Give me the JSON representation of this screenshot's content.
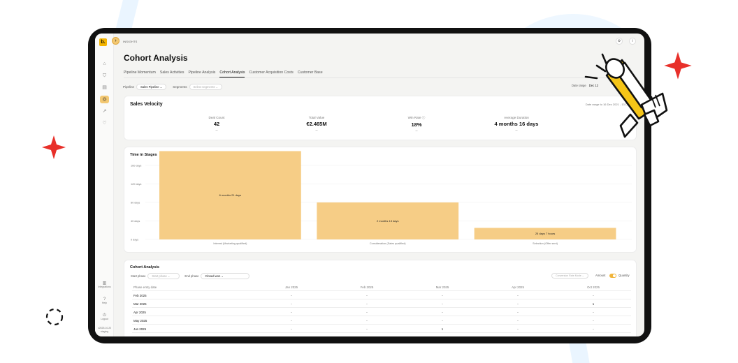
{
  "app": {
    "logo_text": "b.",
    "expand_icon": "›",
    "breadcrumb": "INSIGHTS",
    "topbar_icons": [
      "gear-icon",
      "info-icon"
    ],
    "topbar_glyphs": [
      "⚙",
      "i"
    ]
  },
  "sidebar": {
    "icons": [
      {
        "name": "home-icon",
        "glyph": "⌂",
        "active": false
      },
      {
        "name": "shield-icon",
        "glyph": "⛉",
        "active": false
      },
      {
        "name": "document-icon",
        "glyph": "▤",
        "active": false
      },
      {
        "name": "target-icon",
        "glyph": "◎",
        "active": true
      },
      {
        "name": "trend-icon",
        "glyph": "↗",
        "active": false
      },
      {
        "name": "heart-icon",
        "glyph": "♡",
        "active": false
      }
    ],
    "bottom": [
      {
        "name": "integrations-item",
        "icon": "▥",
        "label": "Integrations"
      },
      {
        "name": "help-item",
        "icon": "?",
        "label": "Help"
      },
      {
        "name": "logout-item",
        "icon": "⏻",
        "label": "Logout"
      }
    ],
    "version": "v2025.10.20",
    "version_sub": "staging"
  },
  "page": {
    "title": "Cohort Analysis",
    "tabs": [
      {
        "label": "Pipeline Momentum",
        "active": false
      },
      {
        "label": "Sales Activities",
        "active": false
      },
      {
        "label": "Pipeline Analysis",
        "active": false
      },
      {
        "label": "Cohort Analysis",
        "active": true
      },
      {
        "label": "Customer Acquisition Costs",
        "active": false
      },
      {
        "label": "Customer Base",
        "active": false
      }
    ]
  },
  "filters": {
    "pipeline_label": "Pipeline",
    "pipeline_value": "Sales Pipeline ⌄",
    "segments_label": "Segments",
    "segments_placeholder": "Select segments ⌄",
    "date_range_label": "Date range",
    "date_range_value": "Dec 12"
  },
  "sales_velocity": {
    "title": "Sales Velocity",
    "range_note": "Date range to 16 Dec 2021 - 13 Dec",
    "kpis": [
      {
        "label": "Deal Count",
        "value": "42",
        "sub": "--"
      },
      {
        "label": "Total Value",
        "value": "€2.465M",
        "sub": "--"
      },
      {
        "label": "Win Rate ⓘ",
        "value": "18%",
        "sub": "--"
      },
      {
        "label": "Average Duration",
        "value": "4 months 16 days",
        "sub": "--"
      }
    ]
  },
  "time_in_stages": {
    "title": "Time in Stages"
  },
  "chart_data": {
    "type": "bar",
    "title": "Time in Stages",
    "categories": [
      "Interest (Marketing qualified)",
      "Consideration (Sales qualified)",
      "Selection (Offer sent)"
    ],
    "values": [
      191,
      80,
      25
    ],
    "data_labels": [
      "6 months 21 days",
      "2 months 13 days",
      "25 days 7 hours"
    ],
    "y_ticks": [
      "0 days",
      "40 days",
      "80 days",
      "120 days",
      "160 days"
    ],
    "ylim": [
      0,
      160
    ],
    "bar_color": "#f6cd86",
    "grid": true
  },
  "cohort": {
    "title": "Cohort Analysis",
    "start_phase_label": "Start phase",
    "start_phase_value": "Start phase ⌄",
    "end_phase_label": "End phase",
    "end_phase_value": "Closed won ⌄",
    "mode_select": "Conversion Rate Mode ⌄",
    "amount_label": "Amount",
    "quantity_label": "Quantity",
    "headers": [
      "Phase entry date",
      "Jan 2025",
      "Feb 2025",
      "Mar 2025",
      "Apr 2025",
      "Oct 2025"
    ],
    "rows": [
      [
        "Feb 2025",
        "-",
        "-",
        "-",
        "-",
        "-"
      ],
      [
        "Mar 2025",
        "-",
        "-",
        "-",
        "-",
        "1"
      ],
      [
        "Apr 2025",
        "-",
        "-",
        "-",
        "-",
        "-"
      ],
      [
        "May 2025",
        "-",
        "-",
        "-",
        "-",
        "-"
      ],
      [
        "Jun 2025",
        "-",
        "-",
        "1",
        "-",
        "-"
      ]
    ]
  },
  "colors": {
    "accent": "#f3c872",
    "bar": "#f6cd86",
    "spark_red": "#e8302a",
    "device_frame": "#111111",
    "megaphone_yellow": "#f5c518"
  }
}
